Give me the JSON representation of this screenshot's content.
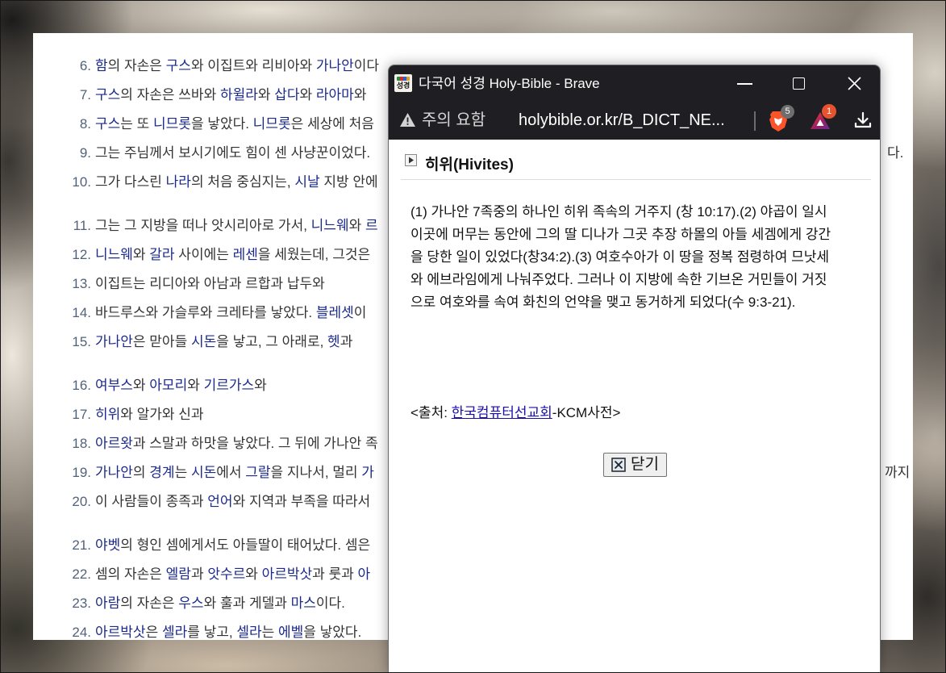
{
  "colors": {
    "link": "#1b2a8c",
    "verse_number": "#52627a",
    "verse_text": "#333333",
    "browser_chrome": "#1f1f23",
    "source_link": "#1a0dab"
  },
  "page": {
    "paragraphs": [
      {
        "verses": [
          {
            "number": "6.",
            "parts": [
              {
                "text": "함",
                "link": true
              },
              {
                "text": "의 자손은 ",
                "link": false
              },
              {
                "text": "구스",
                "link": true
              },
              {
                "text": "와 이집트와 리비아와 ",
                "link": false
              },
              {
                "text": "가나안",
                "link": true
              },
              {
                "text": "이다",
                "link": false
              }
            ]
          },
          {
            "number": "7.",
            "parts": [
              {
                "text": "구스",
                "link": true
              },
              {
                "text": "의 자손은 쓰바와 ",
                "link": false
              },
              {
                "text": "하윌라",
                "link": true
              },
              {
                "text": "와 ",
                "link": false
              },
              {
                "text": "삽다",
                "link": true
              },
              {
                "text": "와 ",
                "link": false
              },
              {
                "text": "라아마",
                "link": true
              },
              {
                "text": "와",
                "link": false
              }
            ]
          },
          {
            "number": "8.",
            "parts": [
              {
                "text": "구스",
                "link": true
              },
              {
                "text": "는 또 ",
                "link": false
              },
              {
                "text": "니므롯",
                "link": true
              },
              {
                "text": "을 낳았다. ",
                "link": false
              },
              {
                "text": "니므롯",
                "link": true
              },
              {
                "text": "은 세상에 처음",
                "link": false
              }
            ]
          },
          {
            "number": "9.",
            "parts": [
              {
                "text": "그는 주님께서 보시기에도 힘이 센 사냥꾼이었다.",
                "link": false
              }
            ]
          },
          {
            "number": "10.",
            "parts": [
              {
                "text": "그가 다스린 ",
                "link": false
              },
              {
                "text": "나라",
                "link": true
              },
              {
                "text": "의 처음 중심지는, ",
                "link": false
              },
              {
                "text": "시날",
                "link": true
              },
              {
                "text": " 지방 안에",
                "link": false
              }
            ]
          }
        ]
      },
      {
        "verses": [
          {
            "number": "11.",
            "parts": [
              {
                "text": "그는 그 지방을 떠나 앗시리아로 가서, ",
                "link": false
              },
              {
                "text": "니느웨",
                "link": true
              },
              {
                "text": "와 ",
                "link": false
              },
              {
                "text": "르",
                "link": true
              }
            ]
          },
          {
            "number": "12.",
            "parts": [
              {
                "text": "니느웨",
                "link": true
              },
              {
                "text": "와 ",
                "link": false
              },
              {
                "text": "갈라",
                "link": true
              },
              {
                "text": " 사이에는 ",
                "link": false
              },
              {
                "text": "레센",
                "link": true
              },
              {
                "text": "을 세웠는데, 그것은",
                "link": false
              }
            ]
          },
          {
            "number": "13.",
            "parts": [
              {
                "text": "이집트는 리디아와 아남과 르합과 납두와",
                "link": false
              }
            ]
          },
          {
            "number": "14.",
            "parts": [
              {
                "text": "바드루스와 가슬루와 크레타를 낳았다. ",
                "link": false
              },
              {
                "text": "블레셋",
                "link": true
              },
              {
                "text": "이",
                "link": false
              }
            ]
          },
          {
            "number": "15.",
            "parts": [
              {
                "text": "가나안",
                "link": true
              },
              {
                "text": "은 맏아들 ",
                "link": false
              },
              {
                "text": "시돈",
                "link": true
              },
              {
                "text": "을 낳고, 그 아래로, ",
                "link": false
              },
              {
                "text": "헷",
                "link": true
              },
              {
                "text": "과",
                "link": false
              }
            ]
          }
        ]
      },
      {
        "verses": [
          {
            "number": "16.",
            "parts": [
              {
                "text": "여부스",
                "link": true
              },
              {
                "text": "와 ",
                "link": false
              },
              {
                "text": "아모리",
                "link": true
              },
              {
                "text": "와 ",
                "link": false
              },
              {
                "text": "기르가스",
                "link": true
              },
              {
                "text": "와",
                "link": false
              }
            ]
          },
          {
            "number": "17.",
            "parts": [
              {
                "text": "히위",
                "link": true
              },
              {
                "text": "와 알가와 신과",
                "link": false
              }
            ]
          },
          {
            "number": "18.",
            "parts": [
              {
                "text": "아르왓",
                "link": true
              },
              {
                "text": "과 스말과 하맛을 낳았다. 그 뒤에 가나안 족",
                "link": false
              }
            ]
          },
          {
            "number": "19.",
            "parts": [
              {
                "text": "가나안",
                "link": true
              },
              {
                "text": "의 ",
                "link": false
              },
              {
                "text": "경계",
                "link": true
              },
              {
                "text": "는 ",
                "link": false
              },
              {
                "text": "시돈",
                "link": true
              },
              {
                "text": "에서 ",
                "link": false
              },
              {
                "text": "그랄",
                "link": true
              },
              {
                "text": "을 지나서, 멀리 ",
                "link": false
              },
              {
                "text": "가",
                "link": true
              }
            ]
          },
          {
            "number": "20.",
            "parts": [
              {
                "text": "이 사람들이 종족과 ",
                "link": false
              },
              {
                "text": "언어",
                "link": true
              },
              {
                "text": "와 지역과 부족을 따라서",
                "link": false
              }
            ]
          }
        ]
      },
      {
        "verses": [
          {
            "number": "21.",
            "parts": [
              {
                "text": "야벳",
                "link": true
              },
              {
                "text": "의 형인 셈에게서도 아들딸이 태어났다. 셈은",
                "link": false
              }
            ]
          },
          {
            "number": "22.",
            "parts": [
              {
                "text": "셈의 자손은 ",
                "link": false
              },
              {
                "text": "엘람",
                "link": true
              },
              {
                "text": "과 ",
                "link": false
              },
              {
                "text": "앗수르",
                "link": true
              },
              {
                "text": "와 ",
                "link": false
              },
              {
                "text": "아르박삿",
                "link": true
              },
              {
                "text": "과 룻과 ",
                "link": false
              },
              {
                "text": "아",
                "link": true
              }
            ]
          },
          {
            "number": "23.",
            "parts": [
              {
                "text": "아람",
                "link": true
              },
              {
                "text": "의 자손은 ",
                "link": false
              },
              {
                "text": "우스",
                "link": true
              },
              {
                "text": "와 훌과 게델과 ",
                "link": false
              },
              {
                "text": "마스",
                "link": true
              },
              {
                "text": "이다.",
                "link": false
              }
            ]
          },
          {
            "number": "24.",
            "parts": [
              {
                "text": "아르박삿",
                "link": true
              },
              {
                "text": "은 ",
                "link": false
              },
              {
                "text": "셀라",
                "link": true
              },
              {
                "text": "를 낳고, ",
                "link": false
              },
              {
                "text": "셀라",
                "link": true
              },
              {
                "text": "는 ",
                "link": false
              },
              {
                "text": "에벨",
                "link": true
              },
              {
                "text": "을 낳았다.",
                "link": false
              }
            ]
          }
        ]
      }
    ],
    "overflow_fragments": {
      "verse_9_tail": "다.",
      "verse_19_tail": "까지 이"
    }
  },
  "popup": {
    "title_bar": {
      "favicon_label": "성경",
      "title": "다국어 성경 Holy-Bible - Brave",
      "icons": [
        "minimize-icon",
        "maximize-icon",
        "close-icon"
      ]
    },
    "address_bar": {
      "security_label": "주의 요함",
      "url": "holybible.or.kr/B_DICT_NE...",
      "shields_badge": "5",
      "rewards_badge": "1",
      "icons": [
        "warning-triangle-icon",
        "brave-lion-icon",
        "bat-triangle-icon",
        "download-icon"
      ]
    },
    "content": {
      "entry_title": "히위(Hivites)",
      "definition_lines": [
        "(1) 가나안 7족중의 하나인 히위 족속의 거주지 (창 10:17).(2) 야곱이 일시",
        "이곳에 머무는 동안에 그의 딸 디나가 그곳 추장 하몰의 아들 세겜에게 강간",
        "을 당한 일이 있었다(창34:2).(3) 여호수아가 이 땅을 정복 점령하여 므낫세",
        "와 에브라임에게 나눠주었다. 그러나 이 지방에 속한 기브온 거민들이 거짓",
        "으로 여호와를 속여 화친의 언약을 맺고 동거하게 되었다(수 9:3-21)."
      ],
      "source": {
        "prefix": "<출처: ",
        "link": "한국컴퓨터선교회",
        "suffix": "-KCM사전>"
      },
      "close_button_label": "닫기"
    }
  }
}
